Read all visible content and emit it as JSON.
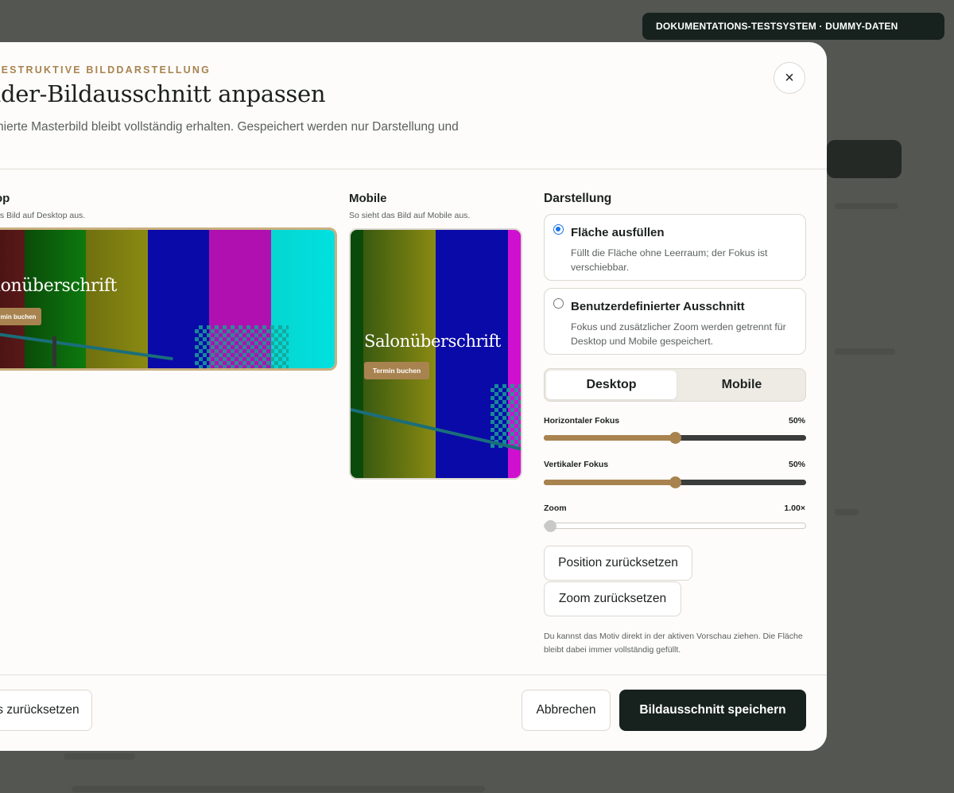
{
  "env_badge": "DOKUMENTATIONS-TESTSYSTEM · DUMMY-DATEN",
  "modal": {
    "eyebrow": "-DESTRUKTIVE BILDDARSTELLUNG",
    "title": "ader-Bildausschnitt anpassen",
    "subtitle": "timierte Masterbild bleibt vollständig erhalten. Gespeichert werden nur Darstellung und",
    "close_icon": "close-icon",
    "close_glyph": "×"
  },
  "previews": {
    "desktop": {
      "label": "op",
      "hint": "as Bild auf Desktop aus.",
      "headline": "lonüberschrift",
      "cta": "min buchen"
    },
    "mobile": {
      "label": "Mobile",
      "hint": "So sieht das Bild auf Mobile aus.",
      "headline": "Salonüberschrift",
      "cta": "Termin buchen"
    }
  },
  "display": {
    "title": "Darstellung",
    "options": [
      {
        "title": "Fläche ausfüllen",
        "desc": "Füllt die Fläche ohne Leerraum; der Fokus ist verschiebbar.",
        "selected": true
      },
      {
        "title": "Benutzerdefinierter Ausschnitt",
        "desc": "Fokus und zusätzlicher Zoom werden getrennt für Desktop und Mobile gespeichert.",
        "selected": false
      }
    ],
    "tabs": [
      "Desktop",
      "Mobile"
    ],
    "active_tab": "Desktop",
    "sliders": [
      {
        "label": "Horizontaler Fokus",
        "value_text": "50%",
        "value": 0.5
      },
      {
        "label": "Vertikaler Fokus",
        "value_text": "50%",
        "value": 0.5
      },
      {
        "label": "Zoom",
        "value_text": "1.00×",
        "value": 0.0
      }
    ],
    "reset_position": "Position zurücksetzen",
    "reset_zoom": "Zoom zurücksetzen",
    "hint": "Du kannst das Motiv direkt in der aktiven Vorschau ziehen. Die Fläche bleibt dabei immer vollständig gefüllt."
  },
  "footer": {
    "reset_all": "s zurücksetzen",
    "cancel": "Abbrechen",
    "save": "Bildausschnitt speichern"
  },
  "colors": {
    "accent": "#a8834f",
    "dark": "#17221e",
    "radio_blue": "#1a73e8"
  }
}
